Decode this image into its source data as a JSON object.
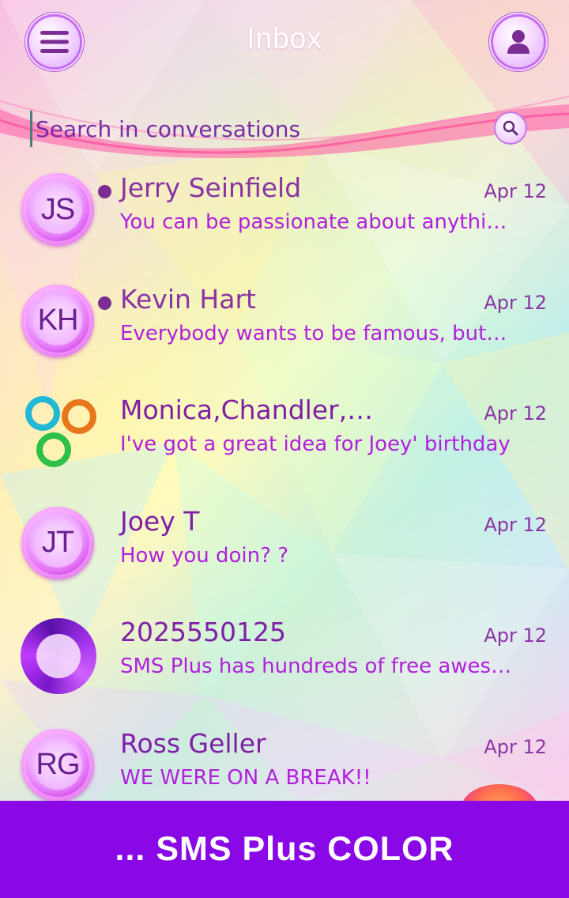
{
  "header": {
    "title": "Inbox",
    "menu_icon": "hamburger-menu-icon",
    "profile_icon": "person-icon"
  },
  "search": {
    "placeholder": "Search in conversations",
    "icon": "search-icon"
  },
  "conversations": [
    {
      "initials": "JS",
      "name": "Jerry Seinfield",
      "date": "Apr 12",
      "snippet": "You can be passionate about anythi…",
      "unread": true,
      "avatar": "initials"
    },
    {
      "initials": "KH",
      "name": "Kevin Hart",
      "date": "Apr 12",
      "snippet": "Everybody wants to be famous, but…",
      "unread": true,
      "avatar": "initials"
    },
    {
      "initials": "",
      "name": "Monica,Chandler,…",
      "date": "Apr 12",
      "snippet": "I've got a great idea for Joey' birthday",
      "unread": false,
      "avatar": "group"
    },
    {
      "initials": "JT",
      "name": "Joey T",
      "date": "Apr 12",
      "snippet": "How you doin? ?",
      "unread": false,
      "avatar": "initials"
    },
    {
      "initials": "",
      "name": "2025550125",
      "date": "Apr 12",
      "snippet": "SMS Plus has hundreds of free awes…",
      "unread": false,
      "avatar": "ring"
    },
    {
      "initials": "RG",
      "name": "Ross Geller",
      "date": "Apr 12",
      "snippet": "WE WERE ON A BREAK!!",
      "unread": false,
      "avatar": "initials"
    }
  ],
  "banner": {
    "text": "... SMS Plus COLOR"
  },
  "colors": {
    "accent": "#8a08e6",
    "text_purple": "#8a34a3",
    "snippet_magenta": "#b21fdd",
    "unread_dot": "#7a2d93"
  }
}
